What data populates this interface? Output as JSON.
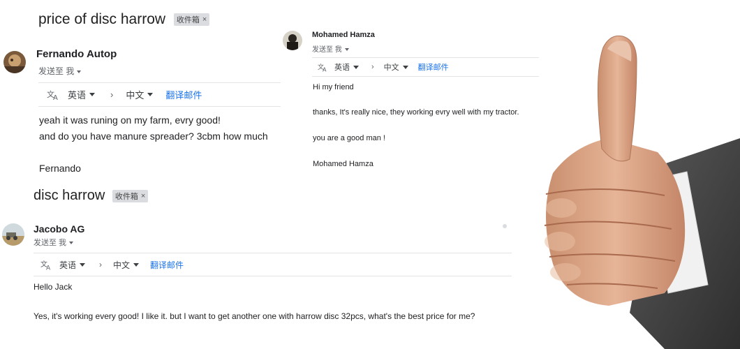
{
  "emails": [
    {
      "subject": "price of disc harrow",
      "label": "收件箱",
      "sender": "Fernando Autop",
      "sent_to": "发送至 我",
      "translate": {
        "from": "英语",
        "to": "中文",
        "link": "翻译邮件"
      },
      "body": [
        "yeah  it was runing on my farm, evry good!",
        "and do you have manure spreader?  3cbm how much",
        "Fernando"
      ]
    },
    {
      "sender": "Mohamed Hamza",
      "sent_to": "发送至 我",
      "translate": {
        "from": "英语",
        "to": "中文",
        "link": "翻译邮件"
      },
      "body": [
        "Hi my friend",
        "thanks,  It's really nice, they working evry well with my tractor.",
        "you are a good man !",
        "Mohamed Hamza"
      ]
    },
    {
      "subject": "disc harrow",
      "label": "收件箱",
      "sender": "Jacobo AG",
      "sent_to": "发送至 我",
      "translate": {
        "from": "英语",
        "to": "中文",
        "link": "翻译邮件"
      },
      "body": [
        "Hello Jack",
        "Yes,  it's working every good!  I like it.  but I want to get another one with harrow disc 32pcs, what's the best price for me?"
      ]
    }
  ],
  "icons": {
    "translate": "translate-icon",
    "remove_label": "close-icon",
    "arrow": "chevron-right-icon",
    "dropdown": "caret-down-icon"
  },
  "colors": {
    "link": "#1a73e8",
    "label_chip": "#dadce0"
  }
}
